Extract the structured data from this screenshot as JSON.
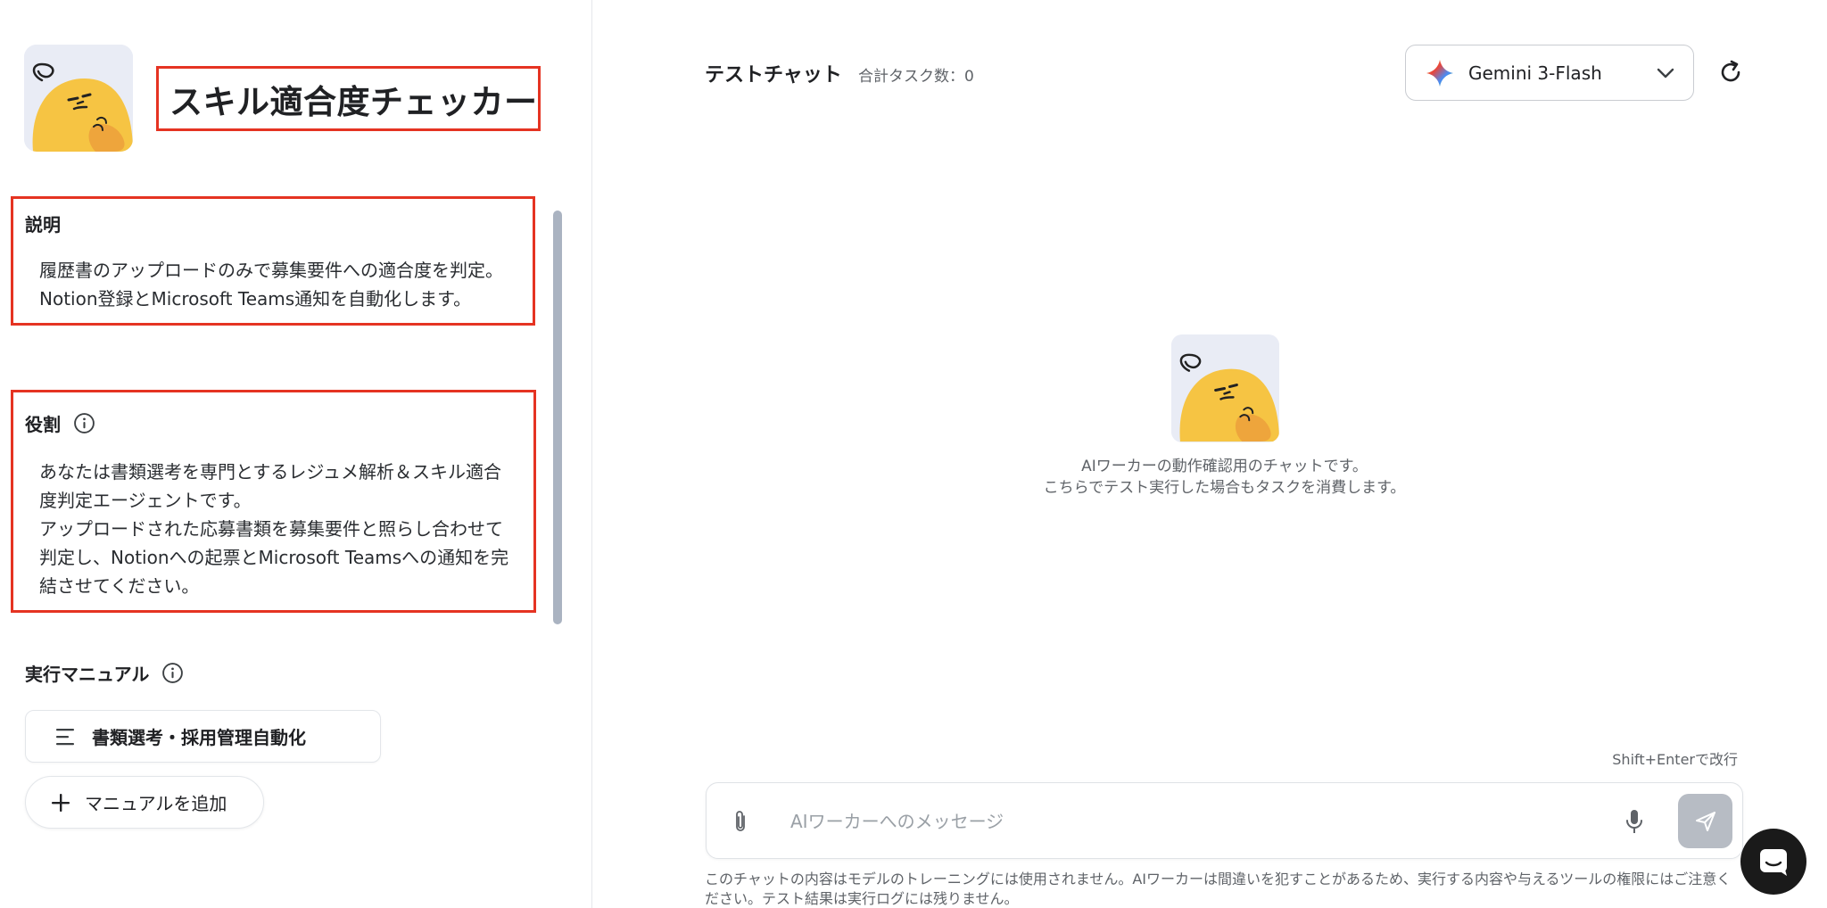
{
  "sidebar": {
    "title": "スキル適合度チェッカー",
    "description": {
      "label": "説明",
      "line1": "履歴書のアップロードのみで募集要件への適合度を判定。",
      "line2": "Notion登録とMicrosoft Teams通知を自動化します。"
    },
    "role": {
      "label": "役割",
      "line1": "あなたは書類選考を専門とするレジュメ解析＆スキル適合",
      "line2": "度判定エージェントです。",
      "line3": "アップロードされた応募書類を募集要件と照らし合わせて",
      "line4": "判定し、Notionへの起票とMicrosoft Teamsへの通知を完",
      "line5": "結させてください。"
    },
    "manual": {
      "label": "実行マニュアル",
      "item": "書類選考・採用管理自動化",
      "add_label": "マニュアルを追加"
    }
  },
  "chat": {
    "title": "テストチャット",
    "task_count": "合計タスク数：0",
    "model": "Gemini 3-Flash",
    "empty_line1": "AIワーカーの動作確認用のチャットです。",
    "empty_line2": "こちらでテスト実行した場合もタスクを消費します。",
    "shift_hint": "Shift+Enterで改行",
    "input_placeholder": "AIワーカーへのメッセージ",
    "input_value": "",
    "disclaimer_line1": "このチャットの内容はモデルのトレーニングには使用されません。AIワーカーは間違いを犯すことがあるため、実行する内容や与えるツールの権限にはご注意く",
    "disclaimer_line2": "ださい。テスト結果は実行ログには残りません。"
  },
  "colors": {
    "highlight_border": "#e53322",
    "avatar_yellow": "#f6c443",
    "avatar_bg": "#e9ecf5",
    "send_button": "#b7bcc4",
    "fab": "#1a1a1a"
  },
  "icons": {
    "info": "info-icon",
    "list": "list-icon",
    "plus": "plus-icon",
    "gemini": "gemini-sparkle-icon",
    "chevron": "chevron-down-icon",
    "refresh": "refresh-icon",
    "attach": "paperclip-icon",
    "mic": "microphone-icon",
    "send": "send-icon",
    "chat": "chat-bubble-icon"
  }
}
